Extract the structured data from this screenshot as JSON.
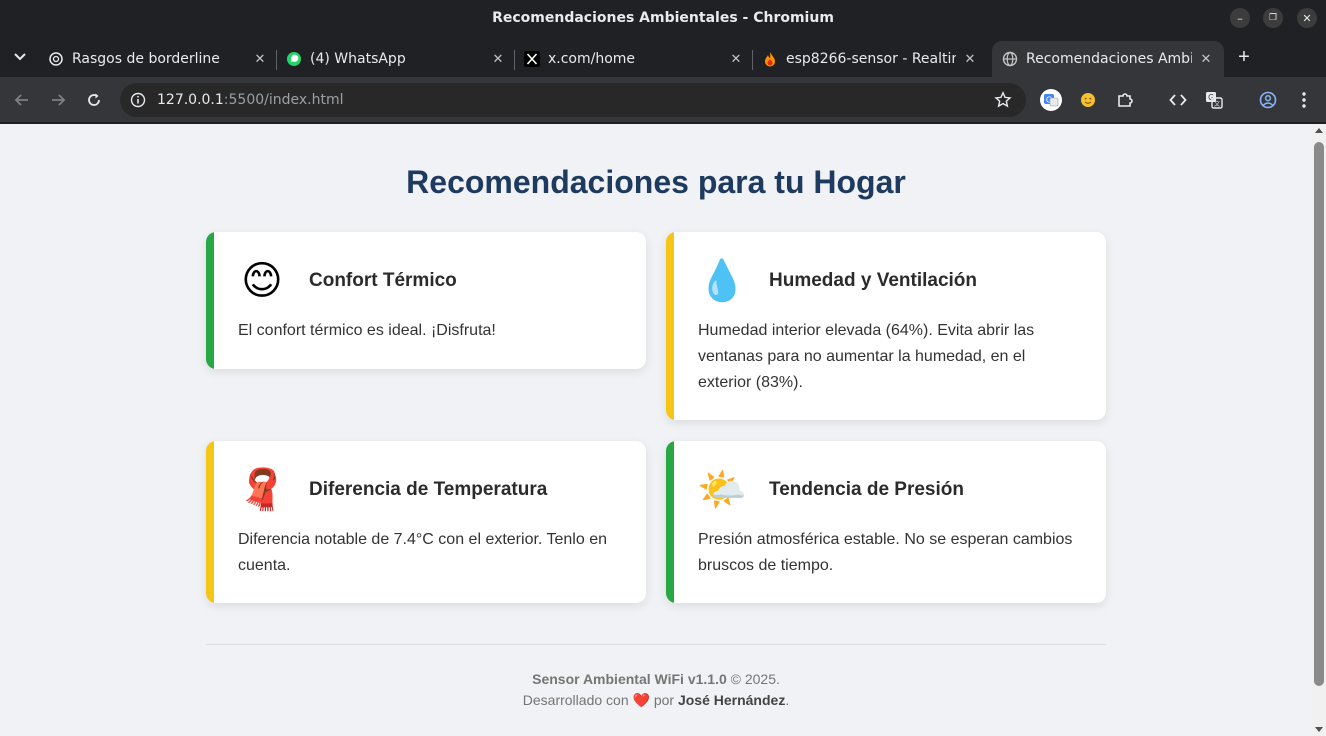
{
  "window": {
    "title": "Recomendaciones Ambientales - Chromium"
  },
  "tabs": [
    {
      "label": "Rasgos de borderline",
      "icon": "chatgpt-icon",
      "active": false
    },
    {
      "label": "(4) WhatsApp",
      "icon": "whatsapp-icon",
      "active": false
    },
    {
      "label": "x.com/home",
      "icon": "x-icon",
      "active": false
    },
    {
      "label": "esp8266-sensor - Realtim",
      "icon": "firebase-icon",
      "active": false
    },
    {
      "label": "Recomendaciones Ambie",
      "icon": "globe-icon",
      "active": true
    }
  ],
  "omnibox": {
    "url_host": "127.0.0.1",
    "url_rest": ":5500/index.html"
  },
  "page": {
    "title": "Recomendaciones para tu Hogar",
    "cards": [
      {
        "emoji": "😊",
        "title": "Confort Térmico",
        "text": "El confort térmico es ideal. ¡Disfruta!",
        "accent": "#28a745"
      },
      {
        "emoji": "💧",
        "title": "Humedad y Ventilación",
        "text": "Humedad interior elevada (64%). Evita abrir las ventanas para no aumentar la humedad, en el exterior (83%).",
        "accent": "#f5c518"
      },
      {
        "emoji": "🧣",
        "title": "Diferencia de Temperatura",
        "text": "Diferencia notable de 7.4°C con el exterior. Tenlo en cuenta.",
        "accent": "#f5c518"
      },
      {
        "emoji": "🌤️",
        "title": "Tendencia de Presión",
        "text": "Presión atmosférica estable. No se esperan cambios bruscos de tiempo.",
        "accent": "#28a745"
      }
    ],
    "footer": {
      "product": "Sensor Ambiental WiFi v1.1.0",
      "copyright": "© 2025.",
      "made_with": "Desarrollado con",
      "heart": "❤️",
      "by": "por",
      "author": "José Hernández",
      "period": "."
    }
  },
  "colors": {
    "title": "#1e3a5f",
    "background": "#f0f2f5",
    "green": "#28a745",
    "yellow": "#f5c518"
  }
}
